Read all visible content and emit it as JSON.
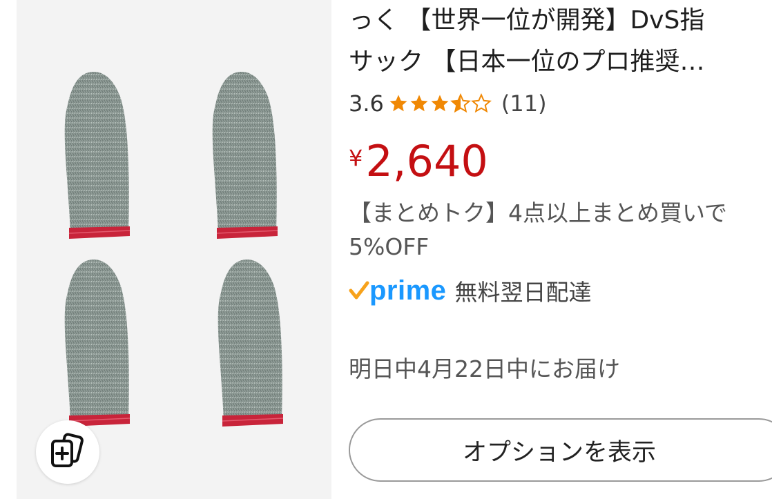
{
  "product": {
    "title_lines": [
      "っく 【世界一位が開発】DvS指",
      "サック 【日本一位のプロ推奨…"
    ],
    "rating": "3.6",
    "rating_value": 3.6,
    "rating_max": 5,
    "review_count": "(11)",
    "currency_symbol": "¥",
    "price": "2,640",
    "deal_lines": [
      "【まとめトク】4点以上まとめ買いで",
      "5%OFF"
    ],
    "prime_logo_text": "prime",
    "prime_shipping": "無料翌日配達",
    "delivery": "明日中4月22日中にお届け",
    "option_button_label": "オプションを表示"
  },
  "icons": {
    "add_to_list": "add-to-list-icon",
    "star_filled": "star-icon",
    "prime_check": "checkmark-icon"
  },
  "colors": {
    "price": "#c40f12",
    "star": "#f08804",
    "prime_blue": "#1a98ff",
    "prime_check": "#f7a21b",
    "cot_gray": "#8e9b96",
    "cot_band": "#c8243a",
    "image_bg": "#f3f3f3"
  }
}
